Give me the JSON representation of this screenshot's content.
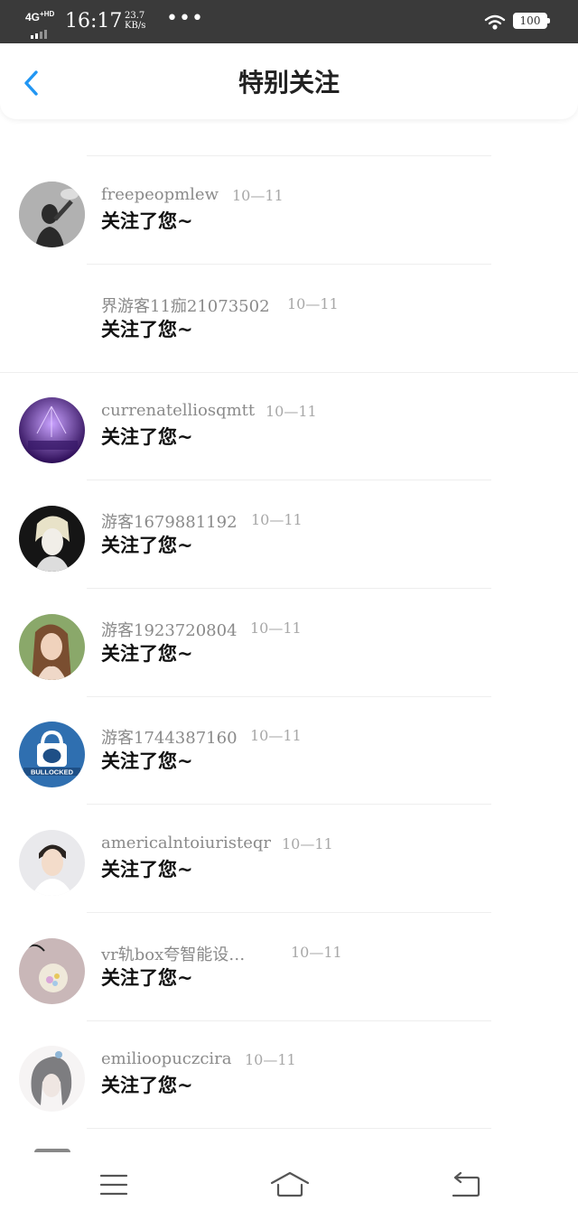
{
  "status_bar": {
    "network": "4G",
    "network_sup": "+HD",
    "time": "16:17",
    "speed_value": "23.7",
    "speed_unit": "KB/s",
    "more": "•••",
    "battery": "100"
  },
  "header": {
    "title": "特别关注"
  },
  "list": {
    "partial_top": {
      "avatar": "avatar-partial-icon"
    },
    "items": [
      {
        "name": "freepeopmlew",
        "date": "10—11",
        "message": "关注了您~",
        "avatar": "man-smoking-avatar"
      },
      {
        "name": "界游客11痂21073502",
        "date": "10—11",
        "message": "关注了您~",
        "avatar": ""
      },
      {
        "name": "currenatelliosqmtt",
        "date": "10—11",
        "message": "关注了您~",
        "avatar": "purple-keyboard-avatar"
      },
      {
        "name": "游客1679881192",
        "date": "10—11",
        "message": "关注了您~",
        "avatar": "anime-character-avatar"
      },
      {
        "name": "游客1923720804",
        "date": "10—11",
        "message": "关注了您~",
        "avatar": "woman-portrait-avatar"
      },
      {
        "name": "游客1744387160",
        "date": "10—11",
        "message": "关注了您~",
        "avatar": "bullocked-logo-avatar",
        "logo_text": "BULLOCKED"
      },
      {
        "name": "americalntoiuristeqr",
        "date": "10—11",
        "message": "关注了您~",
        "avatar": "young-man-avatar"
      },
      {
        "name": "vr轨box夸智能设…",
        "date": "10—11",
        "message": "关注了您~",
        "avatar": "glass-bottle-avatar"
      },
      {
        "name": "emilioopuczcira",
        "date": "10—11",
        "message": "关注了您~",
        "avatar": "sketch-girl-avatar"
      }
    ]
  },
  "colors": {
    "accent": "#2196f3",
    "status_bar_bg": "#3a3a3a",
    "name_text": "#8a8a8a",
    "date_text": "#a8a8a8"
  },
  "bottom_nav": {
    "menu": "menu-icon",
    "home": "home-icon",
    "back": "return-icon"
  }
}
